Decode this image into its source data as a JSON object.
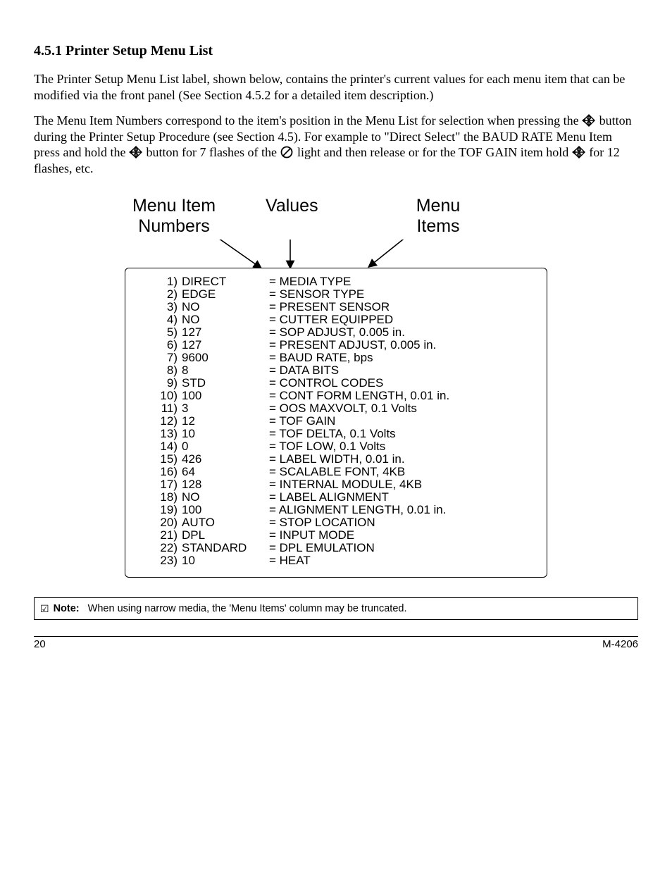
{
  "heading": "4.5.1  Printer Setup Menu List",
  "para1": "The Printer Setup Menu List label, shown below, contains the printer's current values for each menu item that can be modified via the front panel (See Section 4.5.2 for a detailed item description.)",
  "para2_a": "The Menu Item Numbers correspond to the item's position in the Menu List for selection when pressing the ",
  "para2_b": " button during the Printer Setup Procedure (see Section 4.5). For example to \"Direct Select\" the BAUD RATE Menu Item press and hold the ",
  "para2_c": " button for 7 flashes of the ",
  "para2_d": " light and then release or for the TOF GAIN item hold ",
  "para2_e": " for 12 flashes, etc.",
  "diagram_labels": {
    "numbers_1": "Menu Item",
    "numbers_2": "Numbers",
    "values": "Values",
    "items_1": "Menu",
    "items_2": "Items"
  },
  "note_check": "☑",
  "note_label": "Note:",
  "note_text": "When using narrow media, the 'Menu Items' column may be truncated.",
  "footer_left": "20",
  "footer_right": "M-4206",
  "menu": [
    {
      "n": "1)",
      "v": "DIRECT",
      "i": "= MEDIA TYPE"
    },
    {
      "n": "2)",
      "v": "EDGE",
      "i": "= SENSOR TYPE"
    },
    {
      "n": "3)",
      "v": "NO",
      "i": "= PRESENT SENSOR"
    },
    {
      "n": "4)",
      "v": "NO",
      "i": "= CUTTER EQUIPPED"
    },
    {
      "n": "5)",
      "v": "127",
      "i": "= SOP ADJUST,  0.005 in."
    },
    {
      "n": "6)",
      "v": "127",
      "i": "= PRESENT ADJUST, 0.005 in."
    },
    {
      "n": "7)",
      "v": "9600",
      "i": "= BAUD RATE,  bps"
    },
    {
      "n": "8)",
      "v": "8",
      "i": "= DATA BITS"
    },
    {
      "n": "9)",
      "v": "STD",
      "i": "= CONTROL CODES"
    },
    {
      "n": "10)",
      "v": "100",
      "i": "= CONT FORM LENGTH,  0.01 in."
    },
    {
      "n": "11)",
      "v": "3",
      "i": "= OOS MAXVOLT,  0.1 Volts"
    },
    {
      "n": "12)",
      "v": "12",
      "i": "= TOF GAIN"
    },
    {
      "n": "13)",
      "v": "10",
      "i": "= TOF DELTA,  0.1 Volts"
    },
    {
      "n": "14)",
      "v": "0",
      "i": "= TOF LOW,  0.1 Volts"
    },
    {
      "n": "15)",
      "v": "426",
      "i": "= LABEL WIDTH,  0.01 in."
    },
    {
      "n": "16)",
      "v": "64",
      "i": "= SCALABLE FONT,  4KB"
    },
    {
      "n": "17)",
      "v": "128",
      "i": "= INTERNAL MODULE,  4KB"
    },
    {
      "n": "18)",
      "v": "NO",
      "i": "= LABEL ALIGNMENT"
    },
    {
      "n": "19)",
      "v": "100",
      "i": "= ALIGNMENT LENGTH, 0.01 in."
    },
    {
      "n": "20)",
      "v": "AUTO",
      "i": "= STOP LOCATION"
    },
    {
      "n": "21)",
      "v": "DPL",
      "i": "= INPUT MODE"
    },
    {
      "n": "22)",
      "v": "STANDARD",
      "i": "= DPL EMULATION"
    },
    {
      "n": "23)",
      "v": "10",
      "i": "= HEAT"
    }
  ]
}
